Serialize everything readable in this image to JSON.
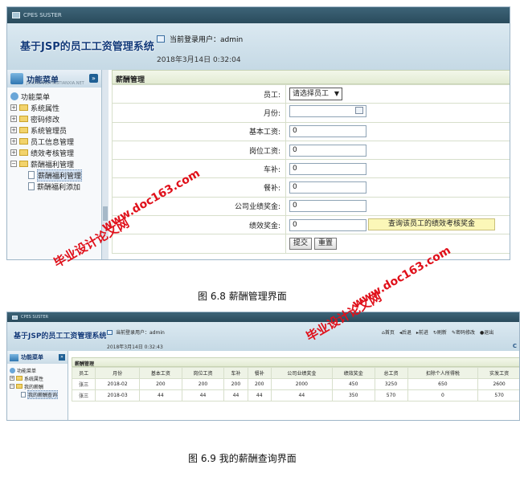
{
  "shot1": {
    "window_title": "CPES SUSTER",
    "system_name": "基于JSP的员工工资管理系统",
    "current_user": "当前登录用户：admin",
    "datetime": "2018年3月14日  0:32:04",
    "menu": {
      "title": "功能菜单",
      "subtitle": "JC.CHUANGYINGTIANXIA.NET",
      "root": "功能菜单",
      "items": [
        "系统属性",
        "密码修改",
        "系统管理员",
        "员工信息管理",
        "绩效考核管理",
        "薪酬福利管理"
      ],
      "children": [
        "薪酬福利管理",
        "薪酬福利添加"
      ]
    },
    "panel_title": "薪酬管理",
    "form": {
      "employee_label": "员工:",
      "employee_select": "请选择员工",
      "month_label": "月份:",
      "month_value": "",
      "base_label": "基本工资:",
      "base_value": "0",
      "post_label": "岗位工资:",
      "post_value": "0",
      "car_label": "车补:",
      "car_value": "0",
      "meal_label": "餐补:",
      "meal_value": "0",
      "company_label": "公司业绩奖金:",
      "company_value": "0",
      "perf_label": "绩效奖金:",
      "perf_value": "0",
      "query_button": "查询该员工的绩效考核奖金",
      "submit_button": "提交",
      "reset_button": "重置"
    }
  },
  "caption1": "图 6.8  薪酬管理界面",
  "shot2": {
    "window_title": "CPES SUSTER",
    "system_name": "基于JSP的员工工资管理系统",
    "current_user": "当前登录用户：admin",
    "datetime": "2018年3月14日  0:32:43",
    "toolbar": [
      "首页",
      "后退",
      "前进",
      "刷新",
      "密码修改",
      "退出"
    ],
    "corner_text": "C",
    "menu": {
      "title": "功能菜单",
      "root": "功能菜单",
      "items": [
        "系统属性",
        "我的薪酬"
      ],
      "children": [
        "我的薪酬查询"
      ]
    },
    "panel_title": "薪酬管理",
    "table": {
      "headers": [
        "员工",
        "月份",
        "基本工资",
        "岗位工资",
        "车补",
        "餐补",
        "公司业绩奖金",
        "绩效奖金",
        "总工资",
        "扣除个人所得税",
        "实发工资"
      ],
      "rows": [
        [
          "张三",
          "2018-02",
          "200",
          "200",
          "200",
          "200",
          "2000",
          "450",
          "3250",
          "650",
          "2600"
        ],
        [
          "张三",
          "2018-03",
          "44",
          "44",
          "44",
          "44",
          "44",
          "350",
          "570",
          "0",
          "570"
        ]
      ]
    }
  },
  "caption2": "图 6.9 我的薪酬查询界面",
  "watermarks": {
    "url": "www.doc163.com",
    "cn": "毕业设计论文网"
  },
  "colors": {
    "watermark": "#e0101a",
    "header_bg": "#c5d9e5",
    "system_name": "#123a7a"
  }
}
